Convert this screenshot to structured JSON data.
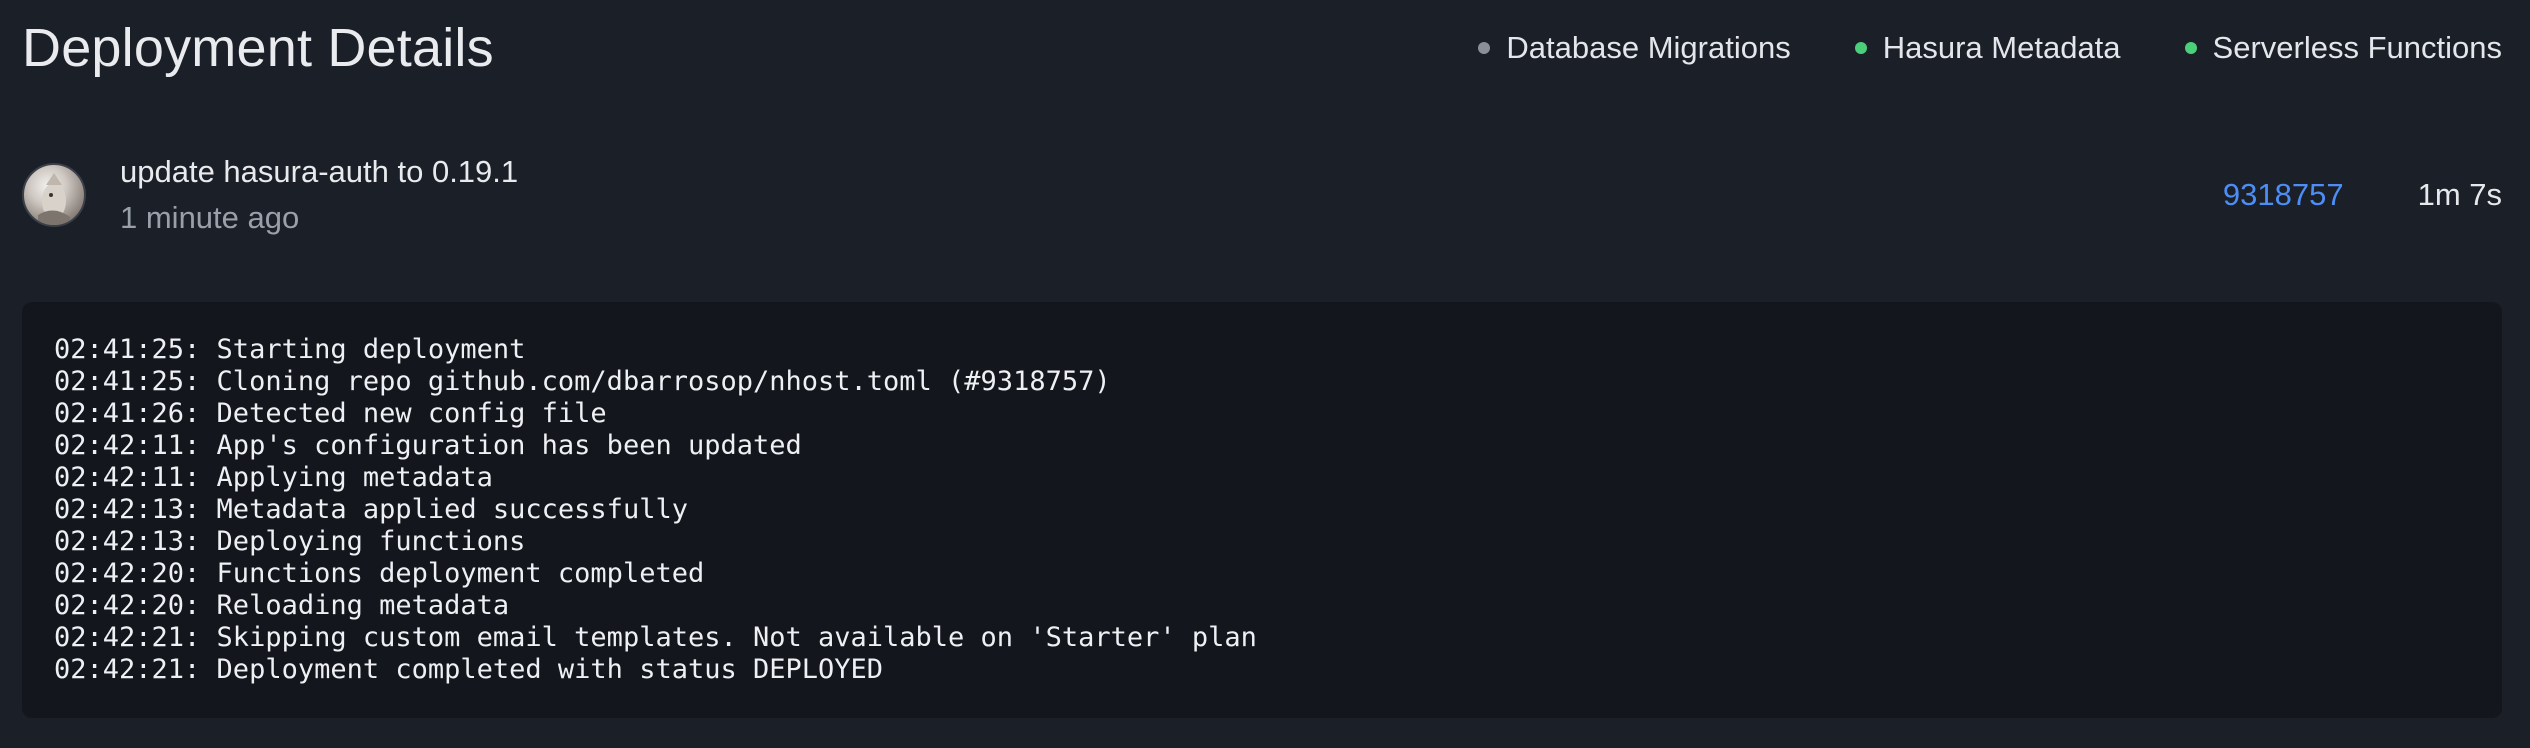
{
  "header": {
    "title": "Deployment Details",
    "services": [
      {
        "label": "Database Migrations",
        "status_color": "#8a8f98"
      },
      {
        "label": "Hasura Metadata",
        "status_color": "#4ccf7a"
      },
      {
        "label": "Serverless Functions",
        "status_color": "#4ccf7a"
      }
    ]
  },
  "commit": {
    "message": "update hasura-auth to 0.19.1",
    "time_ago": "1 minute ago",
    "hash": "9318757",
    "duration": "1m 7s"
  },
  "logs": [
    "02:41:25: Starting deployment",
    "02:41:25: Cloning repo github.com/dbarrosop/nhost.toml (#9318757)",
    "02:41:26: Detected new config file",
    "02:42:11: App's configuration has been updated",
    "02:42:11: Applying metadata",
    "02:42:13: Metadata applied successfully",
    "02:42:13: Deploying functions",
    "02:42:20: Functions deployment completed",
    "02:42:20: Reloading metadata",
    "02:42:21: Skipping custom email templates. Not available on 'Starter' plan",
    "02:42:21: Deployment completed with status DEPLOYED"
  ]
}
